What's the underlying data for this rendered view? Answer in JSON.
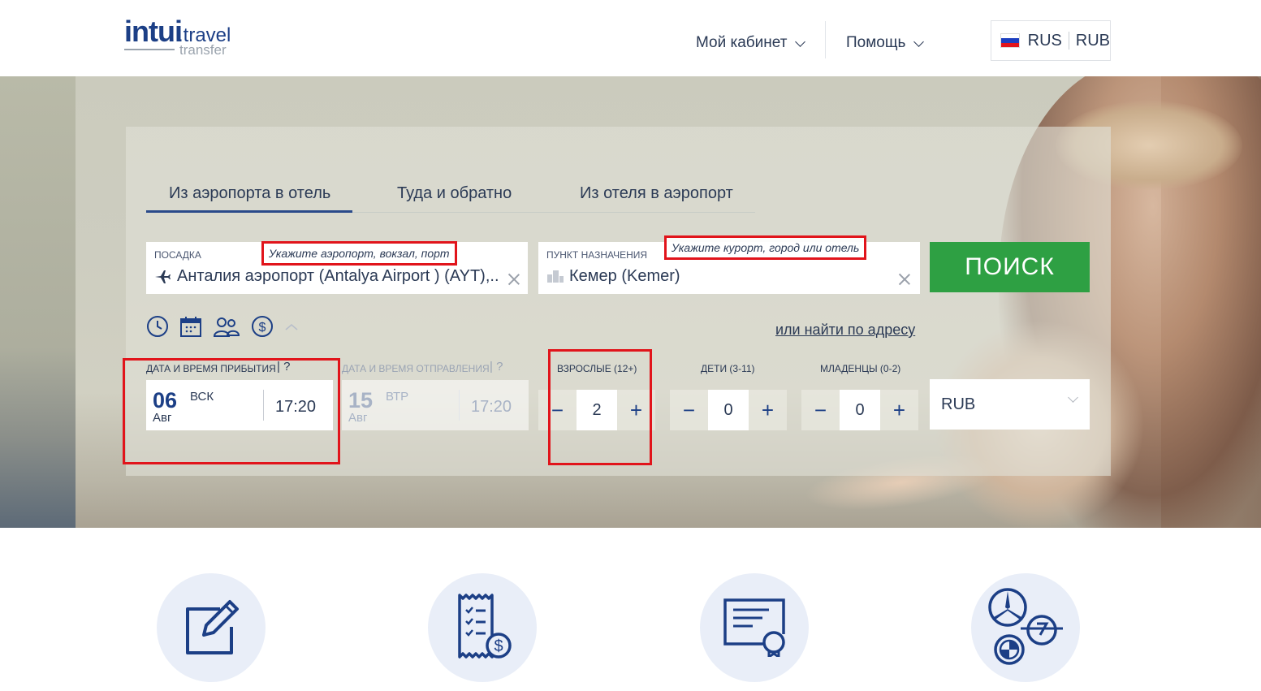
{
  "brand": {
    "name_main": "intui",
    "name_suffix": "travel",
    "tagline": "transfer"
  },
  "header": {
    "cabinet_label": "Мой кабинет",
    "help_label": "Помощь",
    "language": "RUS",
    "currency": "RUB"
  },
  "tabs": [
    {
      "label": "Из аэропорта в отель",
      "active": true
    },
    {
      "label": "Туда и обратно",
      "active": false
    },
    {
      "label": "Из отеля в аэропорт",
      "active": false
    }
  ],
  "pickup": {
    "label": "ПОСАДКА",
    "value": "Анталия аэропорт (Antalya Airport ) (AYT),..",
    "hint": "Укажите аэропорт, вокзал, порт"
  },
  "destination": {
    "label": "ПУНКТ НАЗНАЧЕНИЯ",
    "value": "Кемер (Kemer)",
    "hint": "Укажите курорт, город или отель"
  },
  "search_button": "ПОИСК",
  "address_link": "или найти по адресу",
  "arrival": {
    "label": "ДАТА И ВРЕМЯ ПРИБЫТИЯ",
    "help": "?",
    "day": "06",
    "weekday": "ВСК",
    "month": "Авг",
    "time": "17:20"
  },
  "departure": {
    "label": "ДАТА И ВРЕМЯ ОТПРАВЛЕНИЯ",
    "help": "?",
    "day": "15",
    "weekday": "ВТР",
    "month": "Авг",
    "time": "17:20"
  },
  "passengers": {
    "adults": {
      "label": "ВЗРОСЛЫЕ (12+)",
      "value": "2"
    },
    "children": {
      "label": "ДЕТИ (3-11)",
      "value": "0"
    },
    "infants": {
      "label": "МЛАДЕНЦЫ (0-2)",
      "value": "0"
    },
    "minus": "−",
    "plus": "+"
  },
  "currency_select": "RUB",
  "colors": {
    "accent": "#1c3f86",
    "search_green": "#2ea043",
    "annotation_red": "#e1141b",
    "feature_bg": "#e9eef8"
  },
  "features": [
    {
      "icon": "edit-icon"
    },
    {
      "icon": "receipt-icon"
    },
    {
      "icon": "certificate-icon"
    },
    {
      "icon": "car-brands-icon"
    }
  ]
}
